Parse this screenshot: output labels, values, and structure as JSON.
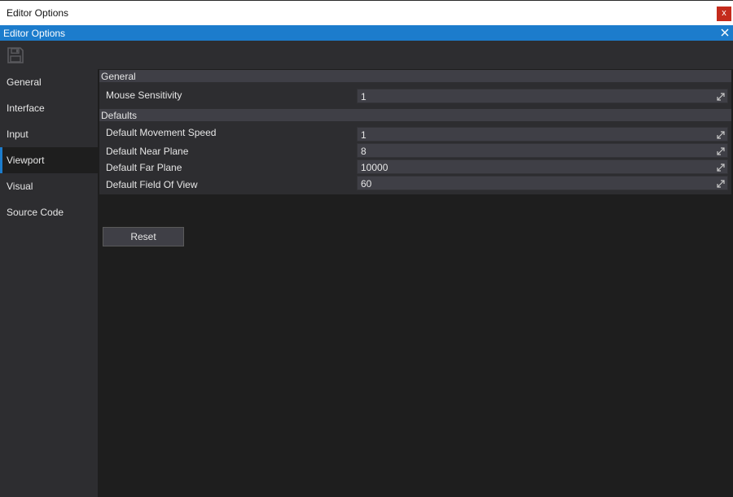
{
  "window": {
    "title": "Editor Options",
    "close_glyph": "x"
  },
  "tab": {
    "title": "Editor Options",
    "close_icon": "close-icon"
  },
  "toolbar": {
    "save_icon": "save-icon"
  },
  "sidebar": {
    "items": [
      {
        "label": "General"
      },
      {
        "label": "Interface"
      },
      {
        "label": "Input"
      },
      {
        "label": "Viewport",
        "active": true
      },
      {
        "label": "Visual"
      },
      {
        "label": "Source Code"
      }
    ]
  },
  "groups": [
    {
      "title": "General",
      "properties": [
        {
          "label": "Mouse Sensitivity",
          "value": "1"
        }
      ]
    },
    {
      "title": "Defaults",
      "properties": [
        {
          "label": "Default Movement Speed",
          "value": "1"
        },
        {
          "label": "Default Near Plane",
          "value": "8"
        },
        {
          "label": "Default Far Plane",
          "value": "10000"
        },
        {
          "label": "Default Field Of View",
          "value": "60"
        }
      ]
    }
  ],
  "reset_label": "Reset",
  "colors": {
    "accent": "#1c7ccc",
    "panel": "#2d2d30",
    "background": "#1e1e1e",
    "field": "#3f3f46"
  }
}
